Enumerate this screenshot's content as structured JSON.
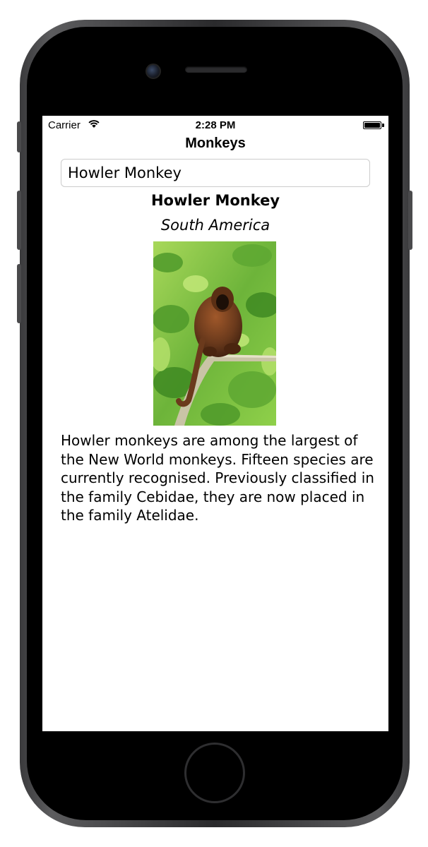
{
  "status_bar": {
    "carrier": "Carrier",
    "time": "2:28 PM",
    "battery_level": 1.0
  },
  "nav": {
    "title": "Monkeys"
  },
  "picker": {
    "value": "Howler Monkey"
  },
  "monkey": {
    "name": "Howler Monkey",
    "location": "South America",
    "details": "Howler monkeys are among the largest of the New World monkeys. Fifteen species are currently recognised. Previously classified in the family Cebidae, they are now placed in the family Atelidae.",
    "image_icon": "howler-monkey-photo"
  },
  "colors": {
    "foliage": "#7cc43c",
    "monkey_fur": "#6b3a1c",
    "screen_bg": "#ffffff",
    "device_body": "#000000"
  }
}
